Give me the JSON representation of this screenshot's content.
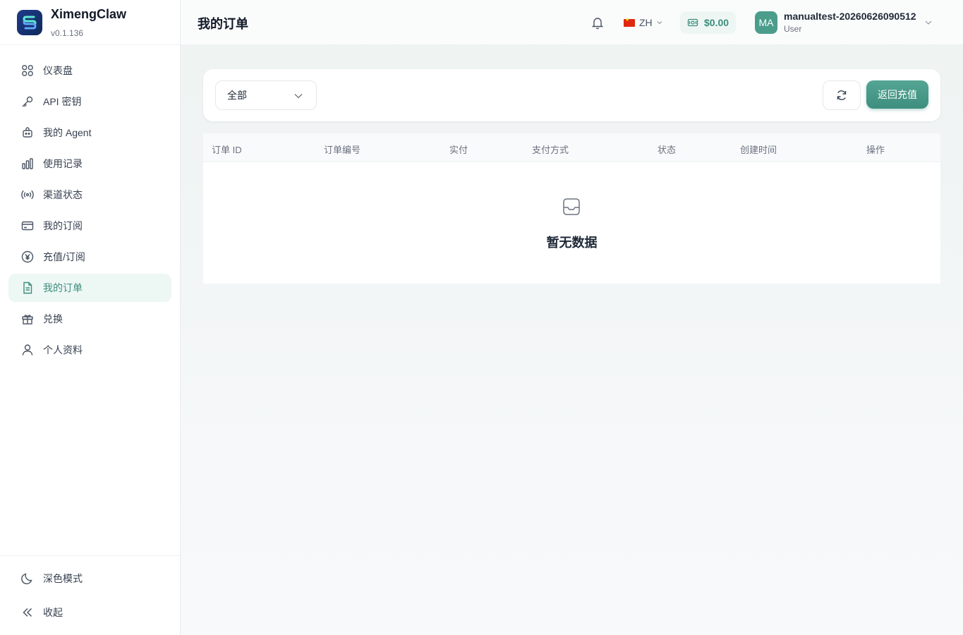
{
  "brand": {
    "name": "XimengClaw",
    "version": "v0.1.136"
  },
  "sidebar": {
    "items": [
      {
        "label": "仪表盘",
        "icon": "dashboard-icon"
      },
      {
        "label": "API 密钥",
        "icon": "key-icon"
      },
      {
        "label": "我的 Agent",
        "icon": "agent-icon"
      },
      {
        "label": "使用记录",
        "icon": "bar-chart-icon"
      },
      {
        "label": "渠道状态",
        "icon": "signal-icon"
      },
      {
        "label": "我的订阅",
        "icon": "card-icon"
      },
      {
        "label": "充值/订阅",
        "icon": "yen-icon"
      },
      {
        "label": "我的订单",
        "icon": "document-icon",
        "active": true
      },
      {
        "label": "兑换",
        "icon": "gift-icon"
      },
      {
        "label": "个人资料",
        "icon": "user-icon"
      }
    ],
    "bottom": {
      "dark_mode": "深色模式",
      "collapse": "收起"
    }
  },
  "header": {
    "title": "我的订单",
    "language": "ZH",
    "balance": "$0.00",
    "user": {
      "avatar": "MA",
      "name": "manualtest-20260626090512",
      "role": "User"
    }
  },
  "filter": {
    "selected": "全部",
    "recharge_button": "返回充值"
  },
  "table": {
    "columns": [
      "订单 ID",
      "订单编号",
      "实付",
      "支付方式",
      "状态",
      "创建时间",
      "操作"
    ],
    "rows": [],
    "empty_text": "暂无数据"
  },
  "colors": {
    "accent": "#3d8e7e",
    "accent_light": "#edf7f4",
    "avatar": "#4a9d8b"
  }
}
